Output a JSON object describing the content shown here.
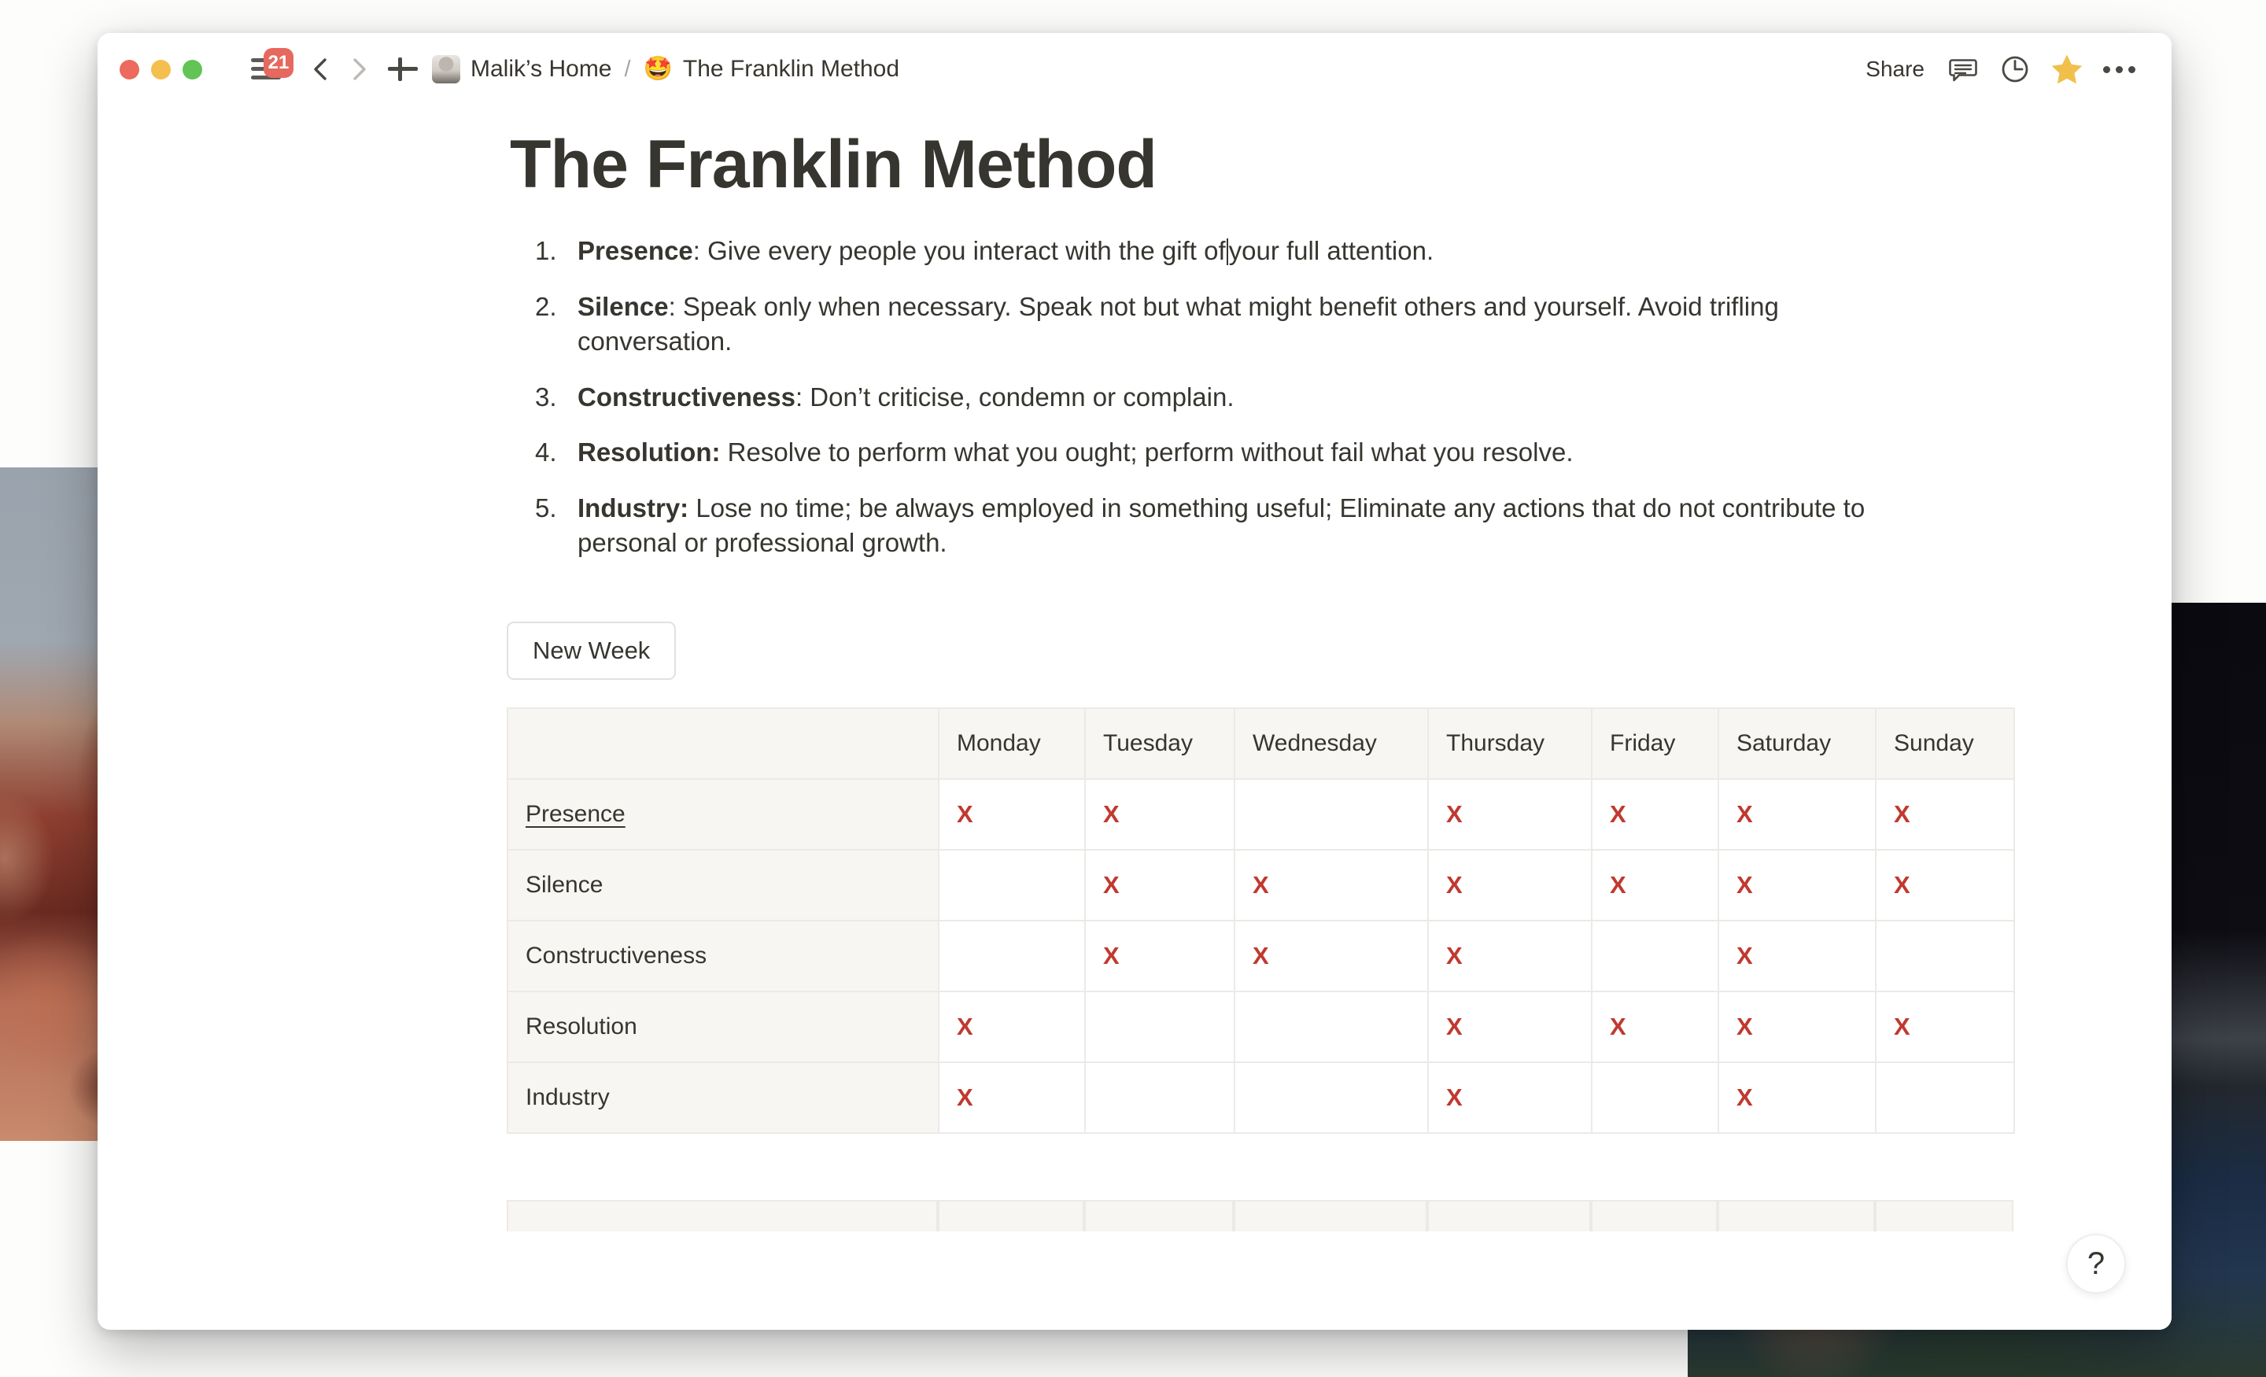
{
  "window": {
    "traffic_lights": [
      "close",
      "minimize",
      "maximize"
    ],
    "colors": {
      "close": "#EC6A5E",
      "minimize": "#F4BF4F",
      "maximize": "#61C454"
    }
  },
  "titlebar": {
    "sidebar_badge_count": "21",
    "back_label": "‹",
    "forward_label": "›",
    "new_page_label": "+",
    "breadcrumb": {
      "home_label": "Malik’s Home",
      "separator": "/",
      "page_emoji": "🤩",
      "page_label": "The Franklin Method"
    },
    "share_label": "Share",
    "icons": {
      "comment": "comment-icon",
      "history": "history-clock-icon",
      "favorite": "star-icon",
      "more": "more-options-icon"
    },
    "favorite_color": "#F0C04B"
  },
  "document": {
    "title": "The Franklin Method",
    "list": [
      {
        "number": "1.",
        "term": "Presence",
        "term_suffix": ":",
        "text_before_caret": " Give every people you interact with the gift of",
        "text_after_caret": "your full attention.",
        "has_caret": true
      },
      {
        "number": "2.",
        "term": "Silence",
        "term_suffix": ":",
        "text": " Speak only when necessary. Speak not but what might benefit others and yourself. Avoid trifling conversation.",
        "has_caret": false
      },
      {
        "number": "3.",
        "term": "Constructiveness",
        "term_suffix": ":",
        "text": " Don’t criticise, condemn or complain.",
        "has_caret": false
      },
      {
        "number": "4.",
        "term": "Resolution:",
        "term_suffix": "",
        "text": " Resolve to perform what you ought; perform without fail what you resolve.",
        "has_caret": false
      },
      {
        "number": "5.",
        "term": "Industry:",
        "term_suffix": "",
        "text": " Lose no time; be always employed in something useful; Eliminate any actions that do not contribute to personal or professional growth.",
        "has_caret": false
      }
    ],
    "new_week_button": "New Week"
  },
  "table": {
    "corner_header": "",
    "columns": [
      "Monday",
      "Tuesday",
      "Wednesday",
      "Thursday",
      "Friday",
      "Saturday",
      "Sunday"
    ],
    "mark": "X",
    "mark_color": "#C0392F",
    "rows": [
      {
        "name": "Presence",
        "is_link": true,
        "marks": [
          true,
          true,
          false,
          true,
          true,
          true,
          true
        ]
      },
      {
        "name": "Silence",
        "is_link": false,
        "marks": [
          false,
          true,
          true,
          true,
          true,
          true,
          true
        ]
      },
      {
        "name": "Constructiveness",
        "is_link": false,
        "marks": [
          false,
          true,
          true,
          true,
          false,
          true,
          false
        ]
      },
      {
        "name": "Resolution",
        "is_link": false,
        "marks": [
          true,
          false,
          false,
          true,
          true,
          true,
          true
        ]
      },
      {
        "name": "Industry",
        "is_link": false,
        "marks": [
          true,
          false,
          false,
          true,
          false,
          true,
          false
        ]
      }
    ]
  },
  "help": {
    "label": "?"
  }
}
